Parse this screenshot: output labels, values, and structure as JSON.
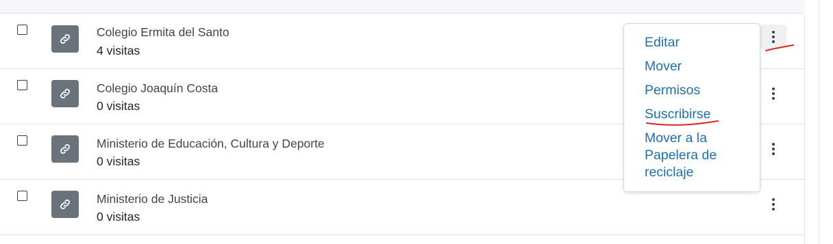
{
  "items": [
    {
      "title": "Colegio Ermita del Santo",
      "visits": "4 visitas"
    },
    {
      "title": "Colegio Joaquín Costa",
      "visits": "0 visitas"
    },
    {
      "title": "Ministerio de Educación, Cultura y Deporte",
      "visits": "0 visitas"
    },
    {
      "title": "Ministerio de Justicia",
      "visits": "0 visitas"
    }
  ],
  "item_icon": "link-icon",
  "actions_icon": "kebab-menu-icon",
  "action_menu": {
    "items": [
      {
        "label": "Editar"
      },
      {
        "label": "Mover"
      },
      {
        "label": "Permisos"
      },
      {
        "label": "Suscribirse"
      },
      {
        "label": "Mover a la Papelera de reciclaje"
      }
    ]
  },
  "colors": {
    "link": "#1d6fb3",
    "annotation": "#e02020",
    "tile": "#6a737b"
  }
}
